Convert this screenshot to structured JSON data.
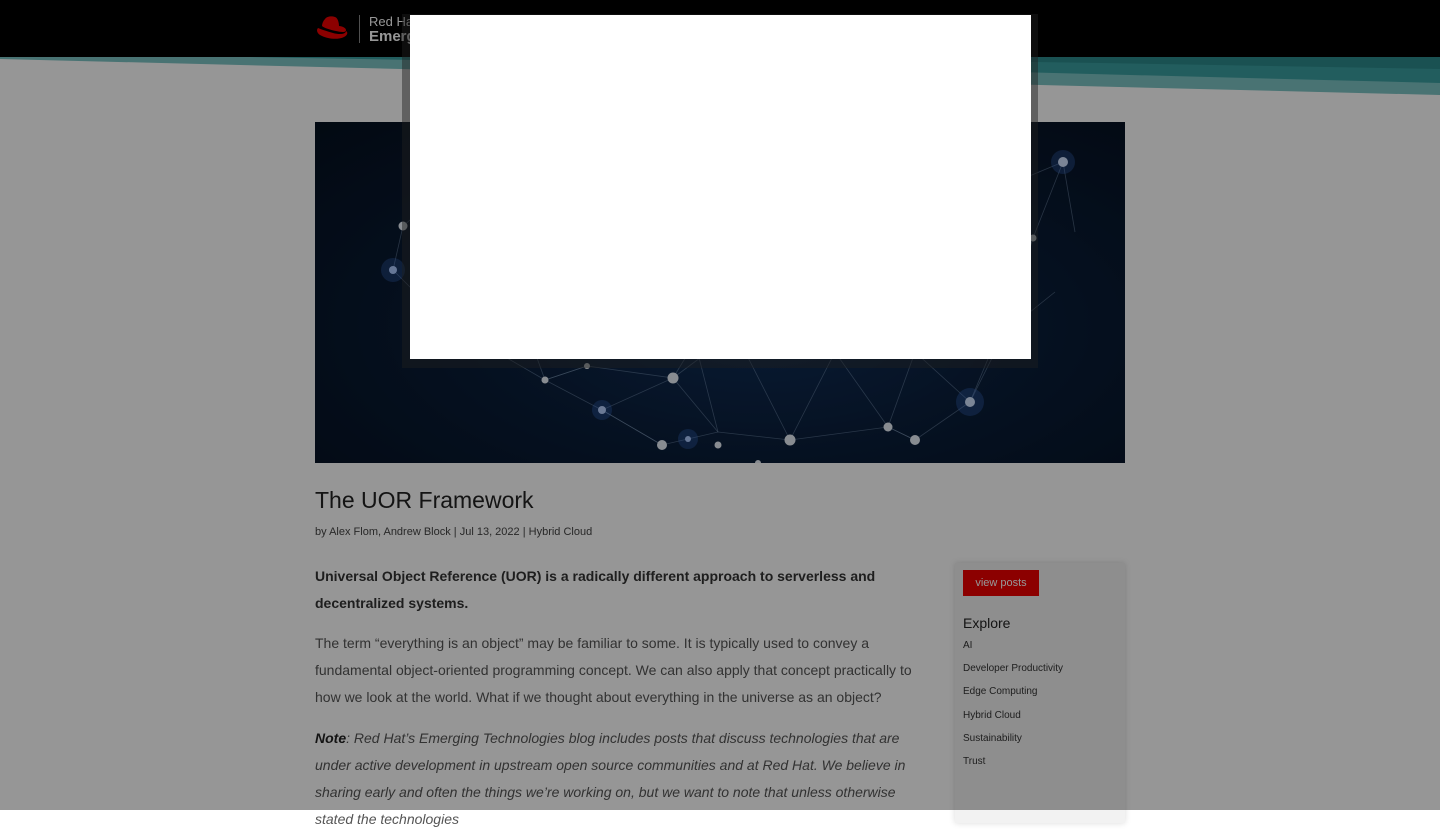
{
  "header": {
    "brand_line1": "Red Hat",
    "brand_line2": "Emerging Technologies"
  },
  "colors": {
    "header_bg": "#000000",
    "accent_teal": "#3a9fa0",
    "brand_red": "#ee0000",
    "overlay": "rgba(0,0,0,0.41)"
  },
  "article": {
    "title": "The UOR Framework",
    "meta_prefix": "by",
    "authors": "Alex Flom, Andrew Block",
    "separator": "|",
    "date": "Jul 13, 2022",
    "category": "Hybrid Cloud",
    "lead": "Universal Object Reference (UOR) is a radically different approach to serverless and decentralized systems.",
    "paragraph1": "The term “everything is an object” may be familiar to some. It is typically used to convey a fundamental object-oriented programming concept. We can also apply that concept practically to how we look at the world. What if we thought about everything in the universe as an object?",
    "note_label": "Note",
    "note_text": ": Red Hat’s Emerging Technologies blog includes posts that discuss technologies that are under active development in upstream open source communities and at Red Hat. We believe in sharing early and often the things we’re working on, but we want to note that unless otherwise stated the technologies"
  },
  "sidebar": {
    "button_label": "view posts",
    "heading": "Explore",
    "categories": [
      "AI",
      "Developer Productivity",
      "Edge Computing",
      "Hybrid Cloud",
      "Sustainability",
      "Trust"
    ]
  },
  "icons": {
    "logo": "red-hat-fedora-icon"
  }
}
